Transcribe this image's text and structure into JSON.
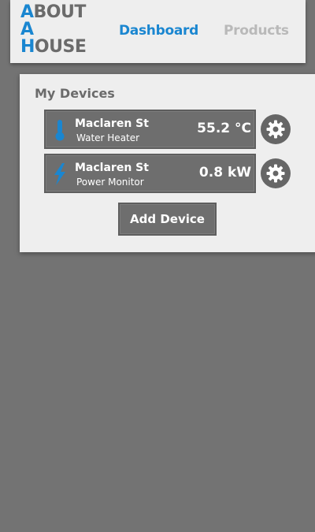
{
  "header": {
    "logo_lines": [
      "ABOUT",
      "A",
      "HOUSE"
    ],
    "nav": [
      {
        "label": "Dashboard",
        "active": true,
        "color": "#1a86d0"
      },
      {
        "label": "Products",
        "active": false,
        "color": "#b9b9b9"
      }
    ]
  },
  "panel": {
    "title": "My Devices",
    "devices": [
      {
        "name": "Maclaren St",
        "type": "Water Heater",
        "value": "55.2 °C",
        "icon": "thermometer-icon"
      },
      {
        "name": "Maclaren St",
        "type": "Power Monitor",
        "value": "0.8 kW",
        "icon": "lightning-icon"
      }
    ],
    "add_button": "Add Device"
  },
  "colors": {
    "accent": "#1a86d0",
    "background": "#737373",
    "panel": "#eeeeee",
    "device_card": "#6e6e6e"
  }
}
